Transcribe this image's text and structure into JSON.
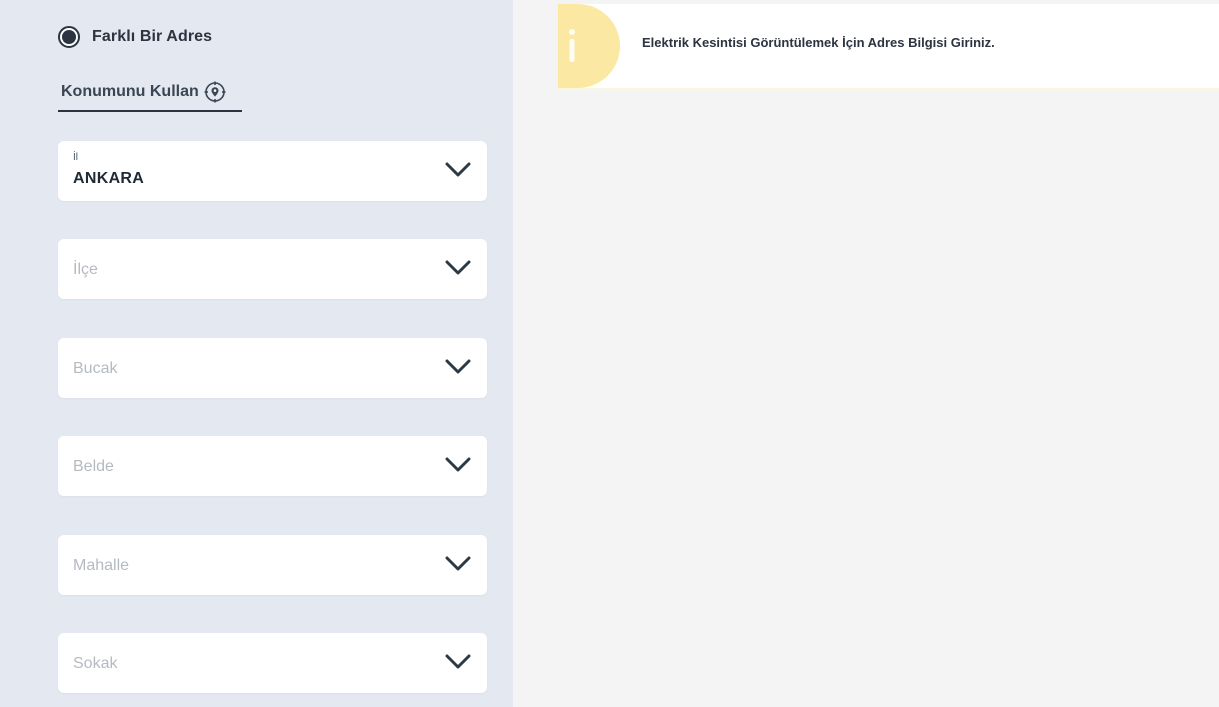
{
  "address_form": {
    "radio_option": {
      "label": "Farklı Bir Adres",
      "selected": true
    },
    "location_link": {
      "label": "Konumunu Kullan",
      "icon": "location-target-icon"
    },
    "fields": {
      "il": {
        "label": "İl",
        "value": "ANKARA"
      },
      "ilce": {
        "placeholder": "İlçe"
      },
      "bucak": {
        "placeholder": "Bucak"
      },
      "belde": {
        "placeholder": "Belde"
      },
      "mahalle": {
        "placeholder": "Mahalle"
      },
      "sokak": {
        "placeholder": "Sokak"
      }
    },
    "dropdown_icon": "chevron-down-icon"
  },
  "info_banner": {
    "icon": "info-icon",
    "message": "Elektrik Kesintisi Görüntülemek İçin Adres Bilgisi Giriniz."
  },
  "colors": {
    "left_panel_bg": "#e4e8f0",
    "right_panel_bg": "#f4f4f4",
    "text_dark": "#2b3440",
    "placeholder": "#b5bac2",
    "info_accent": "#fbe9a3"
  }
}
